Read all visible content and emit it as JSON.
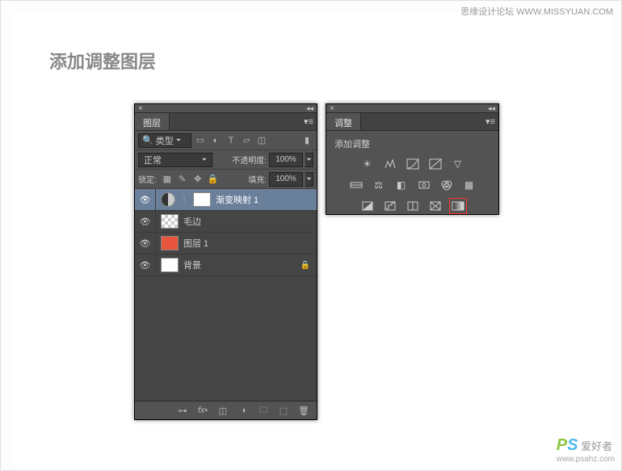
{
  "watermark_top": "思缘设计论坛  WWW.MISSYUAN.COM",
  "page_title": "添加调整图层",
  "watermark_bottom": {
    "brand_p": "P",
    "brand_s": "S",
    "text": "爱好者",
    "url": "www.psahz.com"
  },
  "layers_panel": {
    "tab": "图层",
    "search_type": "类型",
    "blend_mode": "正常",
    "opacity_label": "不透明度:",
    "opacity_value": "100%",
    "lock_label": "锁定:",
    "fill_label": "填充:",
    "fill_value": "100%",
    "layers": [
      {
        "name": "渐变映射 1",
        "kind": "adj-gradient",
        "selected": true
      },
      {
        "name": "毛边",
        "kind": "checker"
      },
      {
        "name": "图层 1",
        "kind": "orange"
      },
      {
        "name": "背景",
        "kind": "white",
        "locked": true
      }
    ]
  },
  "adjust_panel": {
    "tab": "调整",
    "title": "添加调整"
  }
}
